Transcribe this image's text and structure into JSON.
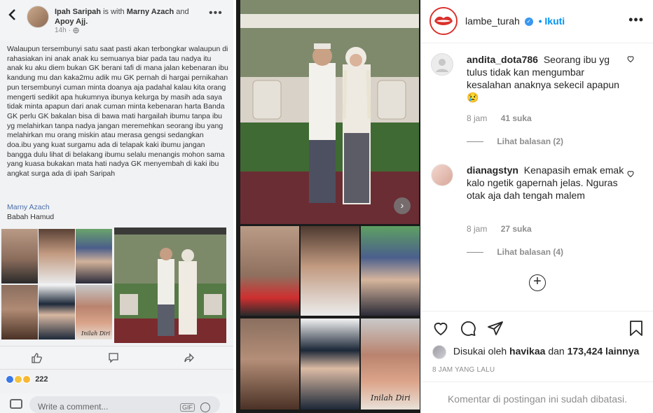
{
  "facebook": {
    "author": "Ipah Saripah",
    "with_text": "is with",
    "tagged_1": "Marny Azach",
    "and_text": "and",
    "tagged_2": "Apoy Ajj.",
    "time": "14h · ",
    "body": "Walaupun tersembunyi satu saat pasti akan terbongkar walaupun di rahasiakan ini anak anak ku semuanya biar pada tau nadya itu anak ku aku diem bukan GK berani tafi di mana jalan kebenaran ibu kandung mu dan kaka2mu adik mu GK pernah di hargai pernikahan pun tersembunyi cuman minta doanya aja padahal kalau kita orang mengerti sedikit apa hukumnya ibunya kelurga by masih ada saya tidak minta apapun dari anak cuman minta kebenaran harta Banda GK perlu GK bakalan bisa di bawa mati hargailah ibumu tanpa ibu yg melahirkan tanpa nadya jangan meremehkan seorang ibu yang melahirkan mu orang miskin atau merasa gengsi sedangkan doa.ibu yang kuat surgamu ada di telapak kaki ibumu jangan bangga dulu lihat di belakang ibumu selalu menangis mohon sama yang kuasa bukakan mata hati nadya GK menyembah di kaki ibu angkat surga ada di ipah Saripah",
    "tag_link": "Marny Azach",
    "tag_plain": "Babah Hamud",
    "collage_caption": "Inilah Diri",
    "reaction_count": "222",
    "comment_placeholder": "Write a comment...",
    "gif_label": "GIF"
  },
  "instagram": {
    "username": "lambe_turah",
    "verified_glyph": "✓",
    "follow_label": "• Ikuti",
    "more_glyph": "•••",
    "next_glyph": "›",
    "collage_caption": "Inilah Diri",
    "comments": [
      {
        "user": "andita_dota786",
        "text": "Seorang ibu yg tulus tidak kan mengumbar kesalahan anaknya sekecil apapun 😢",
        "time": "8 jam",
        "likes": "41 suka",
        "replies": "Lihat balasan (2)"
      },
      {
        "user": "dianagstyn",
        "text": "Kenapasih emak emak kalo ngetik gapernah jelas. Nguras otak aja dah tengah malem",
        "time": "8 jam",
        "likes": "27 suka",
        "replies": "Lihat balasan (4)"
      }
    ],
    "liked_prefix": "Disukai oleh",
    "liked_user": "havikaa",
    "liked_mid": "dan",
    "liked_count": "173,424 lainnya",
    "date": "8 JAM YANG LALU",
    "comments_closed": "Komentar di postingan ini sudah dibatasi."
  },
  "colors": {
    "accent": "#0095f6",
    "fb_link": "#4a6ea9",
    "brand_red": "#d9312b"
  }
}
